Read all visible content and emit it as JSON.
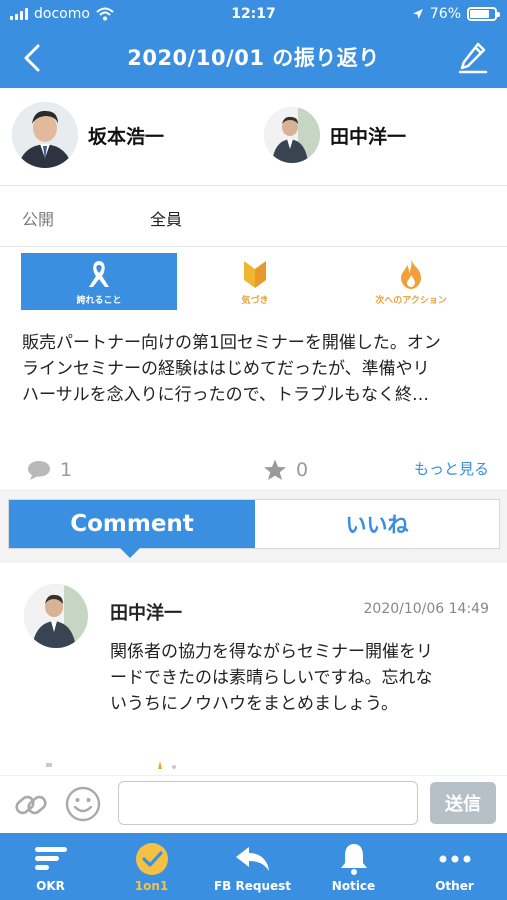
{
  "status_bar": {
    "carrier": "docomo",
    "time": "12:17",
    "battery": "76%"
  },
  "nav": {
    "title": "2020/10/01 の振り返り",
    "back_icon": "chevron-left-icon",
    "edit_icon": "pencil-icon"
  },
  "participants": [
    {
      "name": "坂本浩一"
    },
    {
      "name": "田中洋一"
    }
  ],
  "visibility": {
    "label": "公開",
    "value": "全員"
  },
  "categories": [
    {
      "label": "誇れること",
      "icon": "ribbon-icon",
      "active": true
    },
    {
      "label": "気づき",
      "icon": "leaf-icon",
      "active": false
    },
    {
      "label": "次へのアクション",
      "icon": "flame-icon",
      "active": false
    }
  ],
  "entry": {
    "line1": "販売パートナー向けの第1回セミナーを開催した。オン",
    "line2": "ラインセミナーの経験ははじめてだったが、準備やリ",
    "line3": "ハーサルを念入りに行ったので、トラブルもなく終…",
    "comment_count": "1",
    "star_count": "0",
    "more_label": "もっと見る"
  },
  "segments": {
    "comment": "Comment",
    "like": "いいね",
    "active": "comment"
  },
  "comment": {
    "author": "田中洋一",
    "date": "2020/10/06 14:49",
    "line1": "関係者の協力を得ながらセミナー開催をリ",
    "line2": "ードできたのは素晴らしいですね。忘れな",
    "line3": "いうちにノウハウをまとめましょう。"
  },
  "input": {
    "placeholder": "",
    "send_label": "送信"
  },
  "tabbar": [
    {
      "label": "OKR",
      "icon": "okr-icon",
      "active": false
    },
    {
      "label": "1on1",
      "icon": "check-circle-icon",
      "active": true
    },
    {
      "label": "FB Request",
      "icon": "reply-icon",
      "active": false
    },
    {
      "label": "Notice",
      "icon": "bell-icon",
      "active": false
    },
    {
      "label": "Other",
      "icon": "more-icon",
      "active": false
    }
  ],
  "colors": {
    "primary": "#3b8fe0",
    "accent": "#f3c243",
    "orange": "#e6a23c",
    "send_disabled": "#b7c0c7"
  }
}
